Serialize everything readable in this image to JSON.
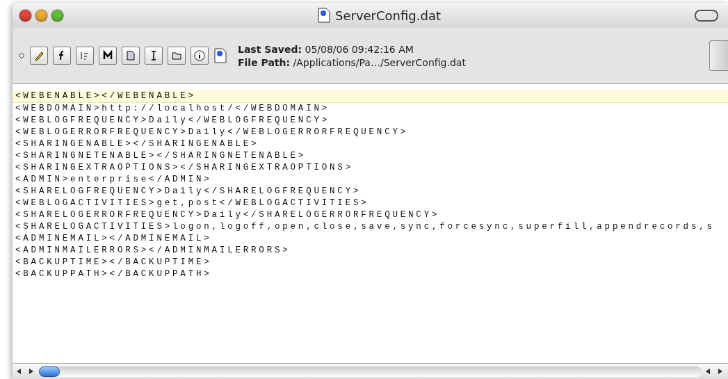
{
  "window": {
    "title": "ServerConfig.dat"
  },
  "info": [
    {
      "label": "Last Saved:",
      "value": "05/08/06 09:42:16 AM"
    },
    {
      "label": "File Path:",
      "value": "/Applications/Pa…/ServerConfig.dat"
    }
  ],
  "lines": [
    {
      "text": "<WEBENABLE></WEBENABLE>",
      "highlighted": true
    },
    {
      "text": "<WEBDOMAIN>http://localhost/</WEBDOMAIN>",
      "highlighted": false
    },
    {
      "text": "<WEBLOGFREQUENCY>Daily</WEBLOGFREQUENCY>",
      "highlighted": false
    },
    {
      "text": "<WEBLOGERRORFREQUENCY>Daily</WEBLOGERRORFREQUENCY>",
      "highlighted": false
    },
    {
      "text": "<SHARINGENABLE></SHARINGENABLE>",
      "highlighted": false
    },
    {
      "text": "<SHARINGNETENABLE></SHARINGNETENABLE>",
      "highlighted": false
    },
    {
      "text": "<SHARINGEXTRAOPTIONS></SHARINGEXTRAOPTIONS>",
      "highlighted": false
    },
    {
      "text": "<ADMIN>enterprise</ADMIN>",
      "highlighted": false
    },
    {
      "text": "<SHARELOGFREQUENCY>Daily</SHARELOGFREQUENCY>",
      "highlighted": false
    },
    {
      "text": "<WEBLOGACTIVITIES>get,post</WEBLOGACTIVITIES>",
      "highlighted": false
    },
    {
      "text": "<SHARELOGERRORFREQUENCY>Daily</SHARELOGERRORFREQUENCY>",
      "highlighted": false
    },
    {
      "text": "<SHARELOGACTIVITIES>logon,logoff,open,close,save,sync,forcesync,superfill,appendrecords,s",
      "highlighted": false
    },
    {
      "text": "<ADMINEMAIL></ADMINEMAIL>",
      "highlighted": false
    },
    {
      "text": "<ADMINMAILERRORS></ADMINMAILERRORS>",
      "highlighted": false
    },
    {
      "text": "<BACKUPTIME></BACKUPTIME>",
      "highlighted": false
    },
    {
      "text": "<BACKUPPATH></BACKUPPATH>",
      "highlighted": false
    }
  ]
}
